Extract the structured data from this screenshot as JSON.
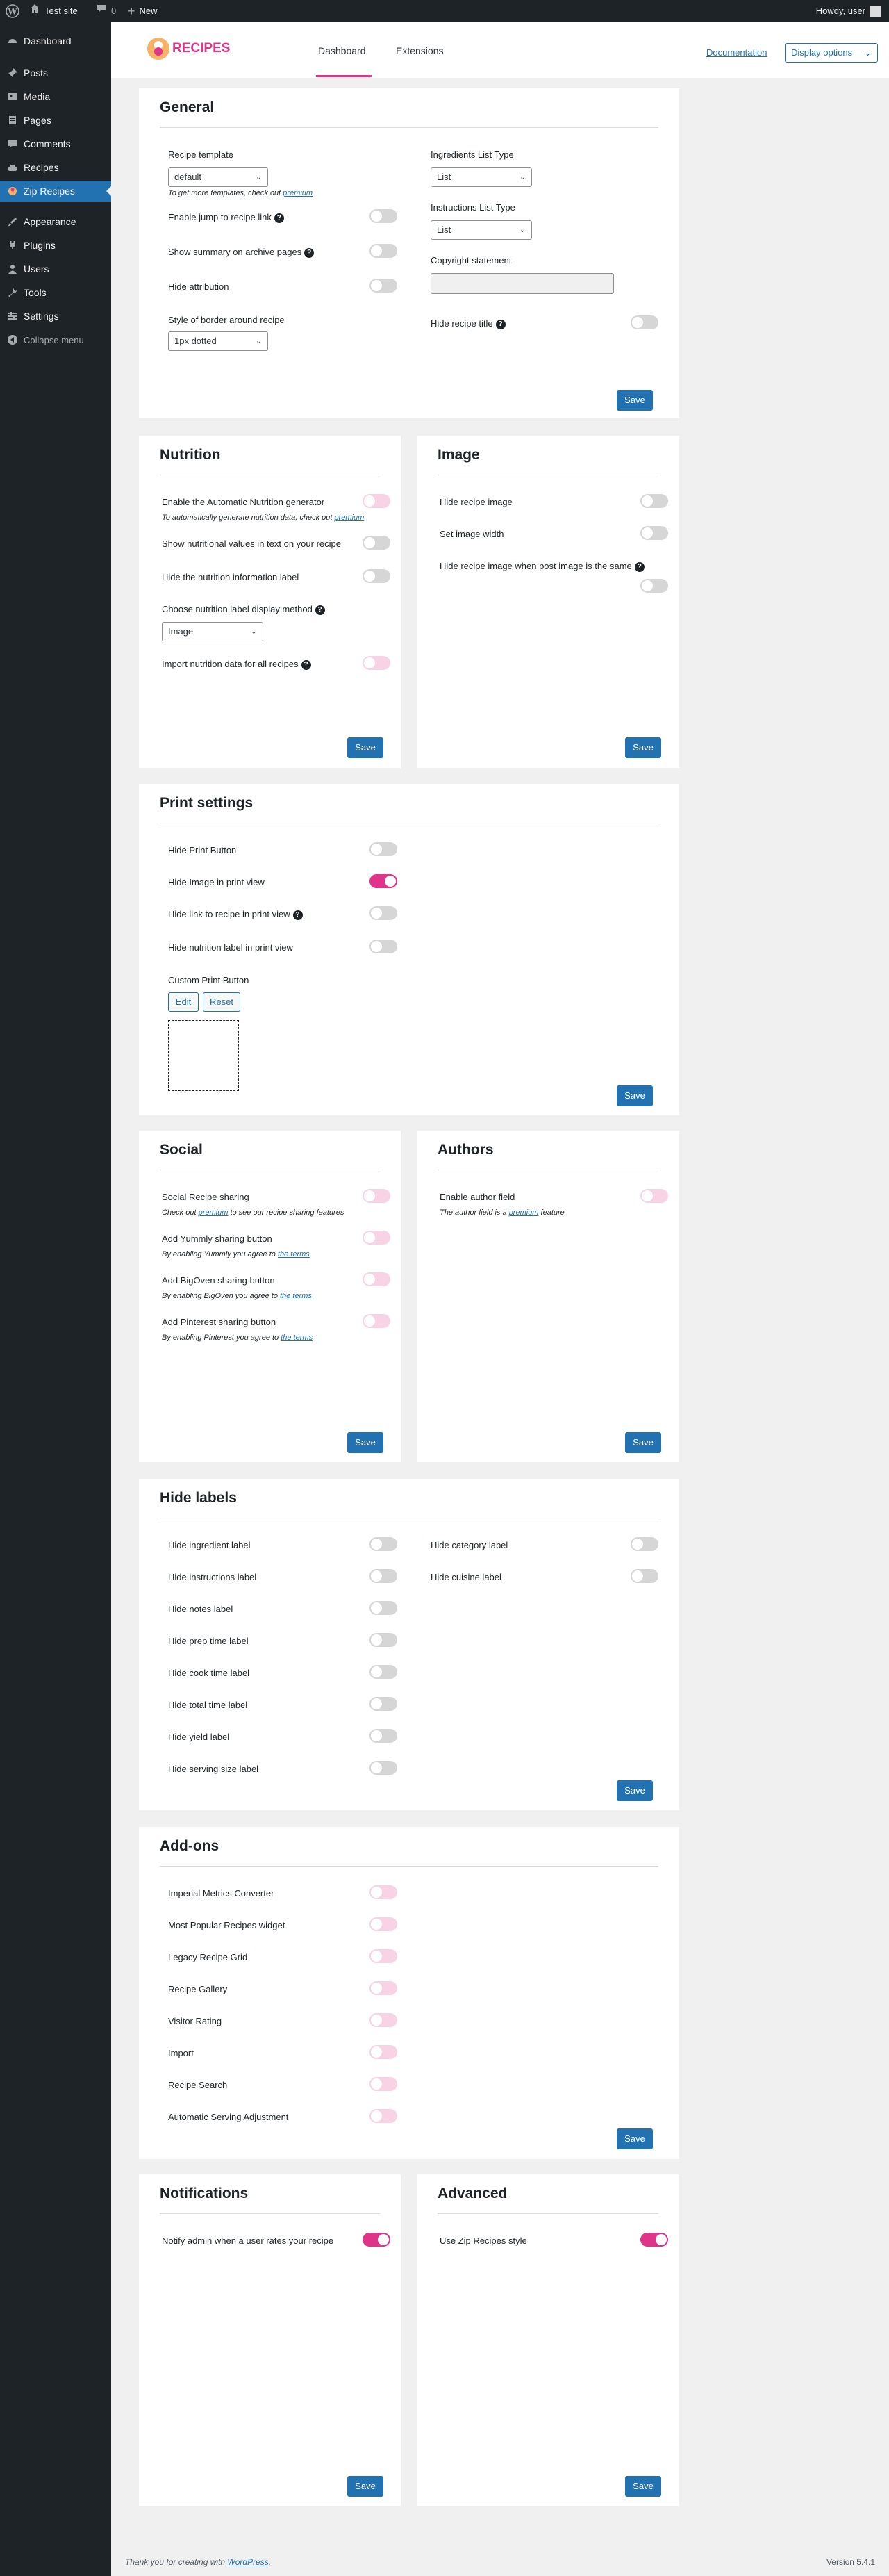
{
  "adminbar": {
    "site_name": "Test site",
    "comments_count": "0",
    "new_label": "New",
    "howdy": "Howdy, user"
  },
  "sidebar": {
    "items": [
      {
        "label": "Dashboard",
        "icon": "dashboard-icon"
      },
      {
        "label": "Posts",
        "icon": "pin-icon"
      },
      {
        "label": "Media",
        "icon": "media-icon"
      },
      {
        "label": "Pages",
        "icon": "pages-icon"
      },
      {
        "label": "Comments",
        "icon": "comments-icon"
      },
      {
        "label": "Recipes",
        "icon": "recipes-icon"
      },
      {
        "label": "Zip Recipes",
        "icon": "zip-recipes-icon"
      },
      {
        "label": "Appearance",
        "icon": "brush-icon"
      },
      {
        "label": "Plugins",
        "icon": "plugin-icon"
      },
      {
        "label": "Users",
        "icon": "users-icon"
      },
      {
        "label": "Tools",
        "icon": "wrench-icon"
      },
      {
        "label": "Settings",
        "icon": "settings-icon"
      },
      {
        "label": "Collapse menu",
        "icon": "collapse-icon"
      }
    ]
  },
  "topnav": {
    "logo_text": "RECIPES",
    "tabs": [
      "Dashboard",
      "Extensions"
    ],
    "documentation": "Documentation",
    "display_options": "Display options"
  },
  "save_label": "Save",
  "general": {
    "title": "General",
    "recipe_template_label": "Recipe template",
    "recipe_template_value": "default",
    "template_note": "To get more templates, check out",
    "premium_link": "premium",
    "jump_link": "Enable jump to recipe link",
    "summary_archive": "Show summary on archive pages",
    "hide_attribution": "Hide attribution",
    "border_style_label": "Style of border around recipe",
    "border_style_value": "1px dotted",
    "ingredients_type_label": "Ingredients List Type",
    "ingredients_type_value": "List",
    "instructions_type_label": "Instructions List Type",
    "instructions_type_value": "List",
    "copyright_label": "Copyright statement",
    "copyright_value": "",
    "hide_title": "Hide recipe title"
  },
  "nutrition": {
    "title": "Nutrition",
    "auto_generator": "Enable the Automatic Nutrition generator",
    "auto_note": "To automatically generate nutrition data, check out",
    "premium_link": "premium",
    "show_text": "Show nutritional values in text on your recipe",
    "hide_label": "Hide the nutrition information label",
    "display_method_label": "Choose nutrition label display method",
    "display_method_value": "Image",
    "import_all": "Import nutrition data for all recipes"
  },
  "image": {
    "title": "Image",
    "hide_image": "Hide recipe image",
    "set_width": "Set image width",
    "hide_when_post": "Hide recipe image when post image is the same"
  },
  "print": {
    "title": "Print settings",
    "hide_button": "Hide Print Button",
    "hide_image": "Hide Image in print view",
    "hide_link": "Hide link to recipe in print view",
    "hide_nutrition": "Hide nutrition label in print view",
    "custom_button": "Custom Print Button",
    "edit": "Edit",
    "reset": "Reset"
  },
  "social": {
    "title": "Social",
    "sharing": "Social Recipe sharing",
    "sharing_note_pre": "Check out",
    "sharing_note_link": "premium",
    "sharing_note_post": "to see our recipe sharing features",
    "yummly": "Add Yummly sharing button",
    "yummly_note": "By enabling Yummly you agree to",
    "bigoven": "Add BigOven sharing button",
    "bigoven_note": "By enabling BigOven you agree to",
    "pinterest": "Add Pinterest sharing button",
    "pinterest_note": "By enabling Pinterest you agree to",
    "terms_link": "the terms"
  },
  "authors": {
    "title": "Authors",
    "enable": "Enable author field",
    "note_pre": "The author field is a",
    "note_link": "premium",
    "note_post": "feature"
  },
  "hide_labels": {
    "title": "Hide labels",
    "left": [
      "Hide ingredient label",
      "Hide instructions label",
      "Hide notes label",
      "Hide prep time label",
      "Hide cook time label",
      "Hide total time label",
      "Hide yield label",
      "Hide serving size label"
    ],
    "right": [
      "Hide category label",
      "Hide cuisine label"
    ]
  },
  "addons": {
    "title": "Add-ons",
    "items": [
      "Imperial Metrics Converter",
      "Most Popular Recipes widget",
      "Legacy Recipe Grid",
      "Recipe Gallery",
      "Visitor Rating",
      "Import",
      "Recipe Search",
      "Automatic Serving Adjustment"
    ]
  },
  "notifications": {
    "title": "Notifications",
    "notify": "Notify admin when a user rates your recipe"
  },
  "advanced": {
    "title": "Advanced",
    "style": "Use Zip Recipes style"
  },
  "footer": {
    "thanks_pre": "Thank you for creating with",
    "thanks_link": "WordPress",
    "thanks_post": ".",
    "version": "Version 5.4.1"
  },
  "colors": {
    "accent": "#2271b1",
    "toggle_on": "#e0338a",
    "toggle_disabled": "#f8d3e5",
    "toggle_off": "#d6d6d6",
    "sidebar": "#1d2327"
  }
}
